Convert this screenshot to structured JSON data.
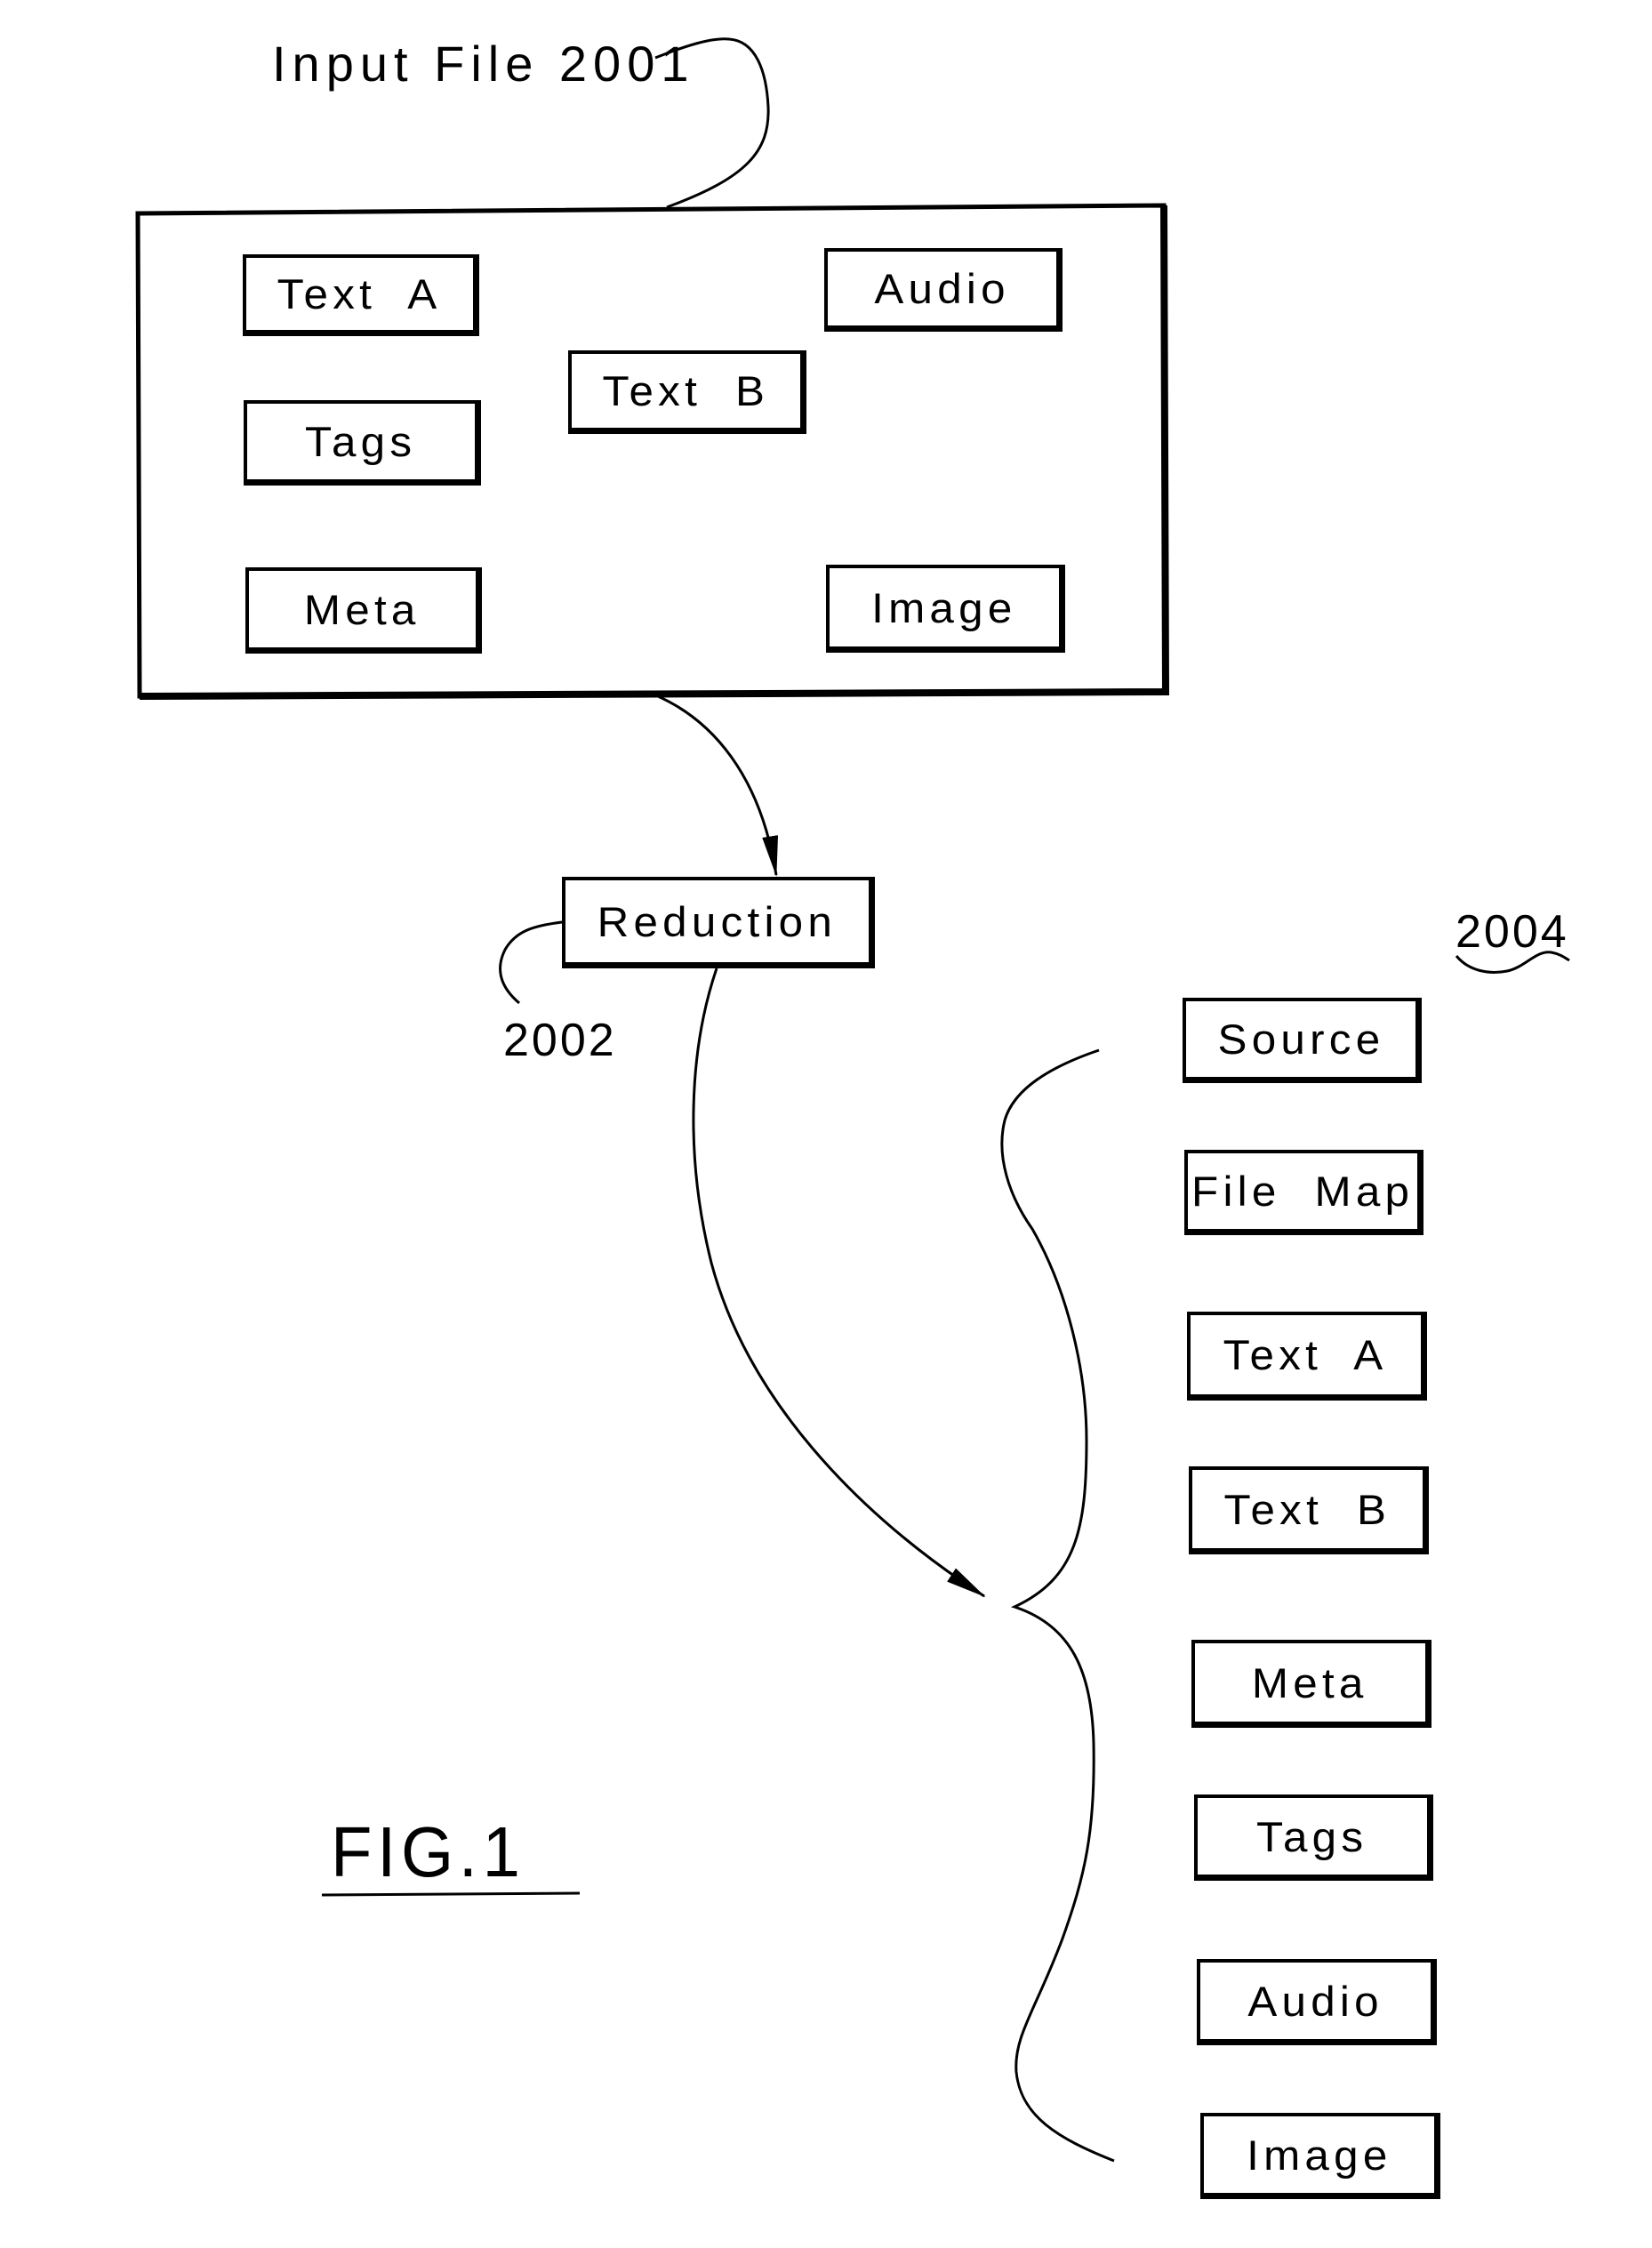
{
  "figure": {
    "label": "FIG.1",
    "type": "block diagram"
  },
  "input_file": {
    "label": "Input File 2001",
    "reference_number": "2001",
    "components": [
      {
        "id": "text_a",
        "label": "Text  A"
      },
      {
        "id": "tags",
        "label": "Tags"
      },
      {
        "id": "meta",
        "label": "Meta"
      },
      {
        "id": "text_b",
        "label": "Text  B"
      },
      {
        "id": "audio",
        "label": "Audio"
      },
      {
        "id": "image",
        "label": "Image"
      }
    ]
  },
  "reduction": {
    "label": "Reduction",
    "reference_number": "2002"
  },
  "output": {
    "reference_number": "2004",
    "components": [
      {
        "id": "source",
        "label": "Source"
      },
      {
        "id": "file_map",
        "label": "File  Map"
      },
      {
        "id": "text_a",
        "label": "Text  A"
      },
      {
        "id": "text_b",
        "label": "Text  B"
      },
      {
        "id": "meta",
        "label": "Meta"
      },
      {
        "id": "tags",
        "label": "Tags"
      },
      {
        "id": "audio",
        "label": "Audio"
      },
      {
        "id": "image",
        "label": "Image"
      }
    ]
  },
  "flow": [
    {
      "from": "input_file",
      "to": "reduction",
      "style": "curved-arrow"
    },
    {
      "from": "reduction",
      "to": "output",
      "style": "curved-arrow"
    }
  ],
  "colors": {
    "ink": "#000000",
    "paper": "#ffffff"
  }
}
